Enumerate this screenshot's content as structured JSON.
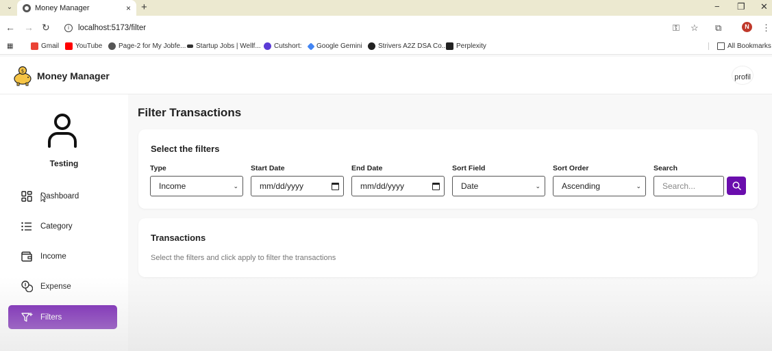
{
  "browser": {
    "tab_title": "Money Manager",
    "tab_close": "×",
    "new_tab": "+",
    "url": "localhost:5173/filter",
    "window_controls": {
      "minimize": "−",
      "restore": "❐",
      "close": "✕"
    },
    "profile_initial": "N",
    "bookmarks": [
      {
        "label": "Gmail",
        "icon": "gmail-icon",
        "color": "#ea4335"
      },
      {
        "label": "YouTube",
        "icon": "youtube-icon",
        "color": "#ff0000"
      },
      {
        "label": "Page-2 for My Jobfe...",
        "icon": "globe-icon",
        "color": "#555555"
      },
      {
        "label": "Startup Jobs | Wellf...",
        "icon": "wellfound-icon",
        "color": "#333333"
      },
      {
        "label": "Cutshort:",
        "icon": "cutshort-icon",
        "color": "#5b3bd6"
      },
      {
        "label": "Google Gemini",
        "icon": "gemini-icon",
        "color": "#4285f4"
      },
      {
        "label": "Strivers A2Z DSA Co...",
        "icon": "striver-icon",
        "color": "#222222"
      },
      {
        "label": "Perplexity",
        "icon": "perplexity-icon",
        "color": "#222222"
      }
    ],
    "all_bookmarks": "All Bookmarks"
  },
  "app": {
    "title": "Money Manager",
    "profile_alt": "profil",
    "accent_color": "#6a0dad"
  },
  "sidebar": {
    "user_name": "Testing",
    "items": [
      {
        "label": "Dashboard",
        "icon": "dashboard-icon",
        "active": false
      },
      {
        "label": "Category",
        "icon": "list-icon",
        "active": false
      },
      {
        "label": "Income",
        "icon": "wallet-icon",
        "active": false
      },
      {
        "label": "Expense",
        "icon": "coins-icon",
        "active": false
      },
      {
        "label": "Filters",
        "icon": "filter-icon",
        "active": true
      }
    ]
  },
  "main": {
    "title": "Filter Transactions",
    "filters": {
      "heading": "Select the filters",
      "type": {
        "label": "Type",
        "value": "Income"
      },
      "start_date": {
        "label": "Start Date",
        "value": "mm/dd/yyyy"
      },
      "end_date": {
        "label": "End Date",
        "value": "mm/dd/yyyy"
      },
      "sort_field": {
        "label": "Sort Field",
        "value": "Date"
      },
      "sort_order": {
        "label": "Sort Order",
        "value": "Ascending"
      },
      "search": {
        "label": "Search",
        "placeholder": "Search..."
      }
    },
    "transactions": {
      "heading": "Transactions",
      "empty_message": "Select the filters and click apply to filter the transactions"
    }
  }
}
